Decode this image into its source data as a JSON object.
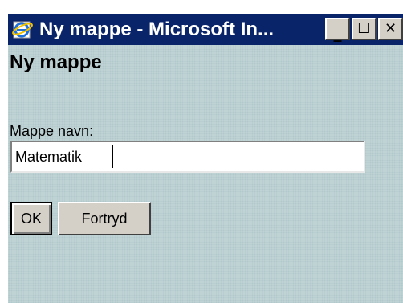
{
  "window": {
    "title": "Ny mappe - Microsoft In...",
    "minimize_glyph": "_",
    "maximize_glyph": "☐",
    "close_glyph": "✕"
  },
  "page": {
    "heading": "Ny mappe",
    "folder_name_label": "Mappe navn:",
    "folder_name_value": "Matematik",
    "ok_label": "OK",
    "cancel_label": "Fortryd"
  },
  "icons": {
    "app": "internet-explorer-icon"
  },
  "colors": {
    "titlebar": "#0a246a",
    "background": "#bfd3d5",
    "button_face": "#d4d0c8"
  }
}
